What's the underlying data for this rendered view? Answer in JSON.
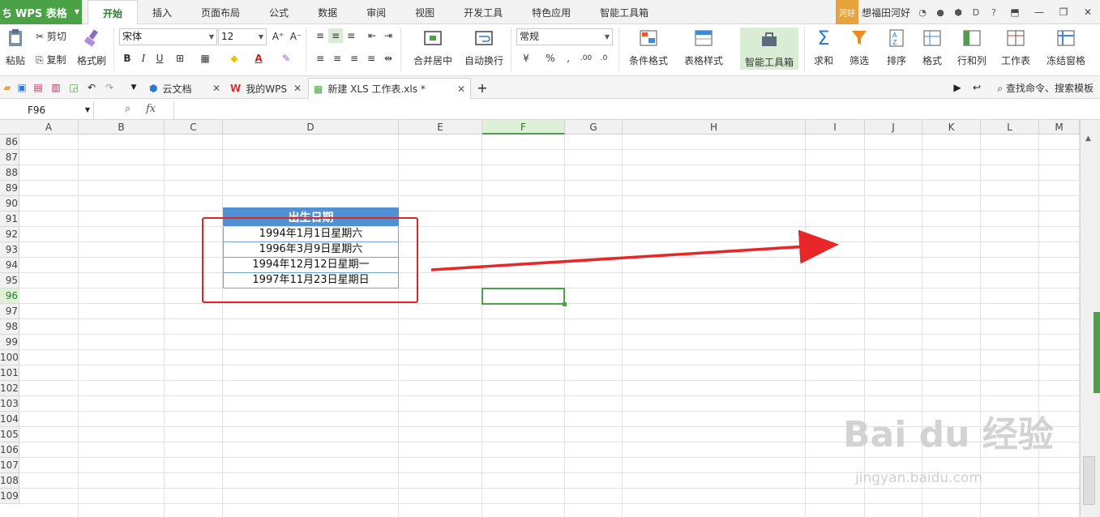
{
  "app": {
    "name": "WPS 表格",
    "logo_glyph": "ち"
  },
  "menu": {
    "tabs": [
      "开始",
      "插入",
      "页面布局",
      "公式",
      "数据",
      "审阅",
      "视图",
      "开发工具",
      "特色应用",
      "智能工具箱"
    ],
    "active": "开始"
  },
  "user": {
    "badge": "河好",
    "name": "想福田河好"
  },
  "ribbon": {
    "paste": "粘贴",
    "cut": "剪切",
    "copy": "复制",
    "format_painter": "格式刷",
    "font_name": "宋体",
    "font_size": "12",
    "bold": "B",
    "italic": "I",
    "underline": "U",
    "merge_center": "合并居中",
    "wrap_text": "自动换行",
    "number_format": "常规",
    "cond_format": "条件格式",
    "table_style": "表格样式",
    "smart_toolbox": "智能工具箱",
    "sum": "求和",
    "filter": "筛选",
    "sort": "排序",
    "format": "格式",
    "row_col": "行和列",
    "sheet": "工作表",
    "freeze": "冻结窗格"
  },
  "doc_tabs": [
    {
      "label": "云文档"
    },
    {
      "label": "我的WPS"
    },
    {
      "label": "新建 XLS 工作表.xls *"
    }
  ],
  "search_cmd": "查找命令、搜索模板",
  "formula": {
    "name_box": "F96",
    "fx": "fx",
    "value": ""
  },
  "grid": {
    "columns": [
      "A",
      "B",
      "C",
      "D",
      "E",
      "F",
      "G",
      "H",
      "I",
      "J",
      "K",
      "L",
      "M"
    ],
    "selected_column": "F",
    "rows": [
      "86",
      "87",
      "88",
      "89",
      "90",
      "91",
      "92",
      "93",
      "94",
      "95",
      "96",
      "97",
      "98",
      "99",
      "100",
      "101",
      "102",
      "103",
      "104",
      "105",
      "106",
      "107",
      "108",
      "109"
    ],
    "selected_row": "96",
    "table_header": "出生日期",
    "table_rows": [
      "1994年1月1日星期六",
      "1996年3月9日星期六",
      "1994年12月12日星期一",
      "1997年11月23日星期日"
    ]
  },
  "watermark": {
    "main": "Bai du 经验",
    "sub": "jingyan.baidu.com"
  },
  "colors": {
    "accent": "#4aa146",
    "header_fill": "#4f91d2",
    "annotation": "#e02525"
  }
}
